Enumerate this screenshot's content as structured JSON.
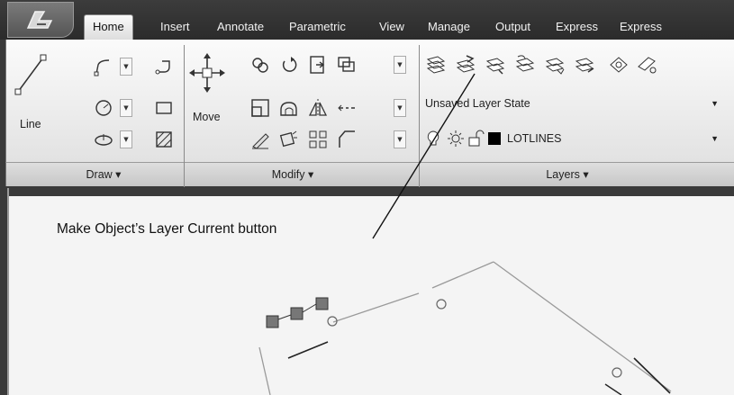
{
  "tabs": [
    {
      "label": "Home",
      "active": true
    },
    {
      "label": "Insert",
      "active": false
    },
    {
      "label": "Annotate",
      "active": false
    },
    {
      "label": "Parametric",
      "active": false
    },
    {
      "label": "View",
      "active": false
    },
    {
      "label": "Manage",
      "active": false
    },
    {
      "label": "Output",
      "active": false
    },
    {
      "label": "Express",
      "active": false
    }
  ],
  "draw_panel": {
    "title": "Draw ▾",
    "line_label": "Line",
    "icons": [
      "polyline-icon",
      "circle-icon",
      "arc-icon",
      "rectangle-icon",
      "ellipse-icon",
      "hatch-icon"
    ]
  },
  "modify_panel": {
    "title": "Modify ▾",
    "move_label": "Move",
    "icons": [
      "copy-icon",
      "rotate-icon",
      "trim-icon",
      "offset-icon",
      "stretch-icon",
      "mirror-icon",
      "fillet-icon",
      "array-icon",
      "scale-icon",
      "chamfer-icon",
      "erase-icon",
      "explode-icon"
    ]
  },
  "layers_panel": {
    "title": "Layers ▾",
    "layer_state": "Unsaved Layer State",
    "current_layer": "LOTLINES",
    "icons": [
      "layer-properties-icon",
      "make-object-layer-current-icon",
      "layer-match-icon",
      "layer-previous-icon",
      "layer-isolate-icon",
      "layer-unisolate-icon",
      "layer-freeze-icon",
      "layer-off-icon"
    ]
  },
  "annotation": {
    "callout": "Make Object’s Layer Current button"
  },
  "colors": {
    "dark_frame": "#3a3a3a",
    "ribbon_bg": "#ececec",
    "current_layer_swatch": "#000000"
  }
}
